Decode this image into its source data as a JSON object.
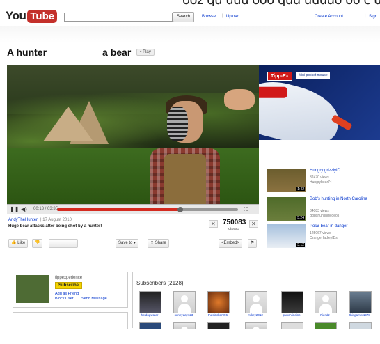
{
  "masthead": {
    "logo_you": "You",
    "logo_tube": "Tube",
    "search_placeholder": "",
    "search_button": "Search",
    "browse": "Browse",
    "upload": "Upload",
    "create_account": "Create Account",
    "sign_in": "Sign",
    "sep": "|",
    "top_text": "ooz qu uuu ooo quu uuuuo oo c uuuu"
  },
  "video": {
    "title_part1": "A hunter",
    "title_part2": "a bear",
    "play_badge": "• Play",
    "time": "00:13 / 03:35",
    "progress": 0.68,
    "uploader": "AndyTheHunter",
    "date": "| 17 August 2010",
    "description": "Huge bear attacks after being shot by a hunter!",
    "views": "750083",
    "views_label": "views"
  },
  "ad": {
    "brand": "Tipp-Ex",
    "tagline": "Mini pocket mouse"
  },
  "actions": {
    "like": "Like",
    "save": "Save to ▾",
    "share": "Share",
    "embed": "<Embed>"
  },
  "sidebar_videos": [
    {
      "title": "Hungry grizzlyID",
      "views": "32470 views",
      "user": "Hungrybear74",
      "duration": "1:42"
    },
    {
      "title": "Bob's hunting in North Carolina",
      "views": "34083 views",
      "user": "Bobshuntingvideos",
      "duration": "5:24"
    },
    {
      "title": "Polar bear in danger",
      "views": "125067 views",
      "user": "OrangeHadleyIDs",
      "duration": "3:12"
    }
  ],
  "channel": {
    "name": "tippexperience",
    "subscribe": "Subscribe",
    "add_friend": "Add as Friend",
    "block_user": "Block User",
    "send_message": "Send Message"
  },
  "subscribers": {
    "title": "Subscribers (2128)",
    "users": [
      "hotdogwater",
      "sunnyday123",
      "theslacker996",
      "mikey2012",
      "punchlineinc",
      "Fiendz",
      "thisgamer1978"
    ]
  }
}
